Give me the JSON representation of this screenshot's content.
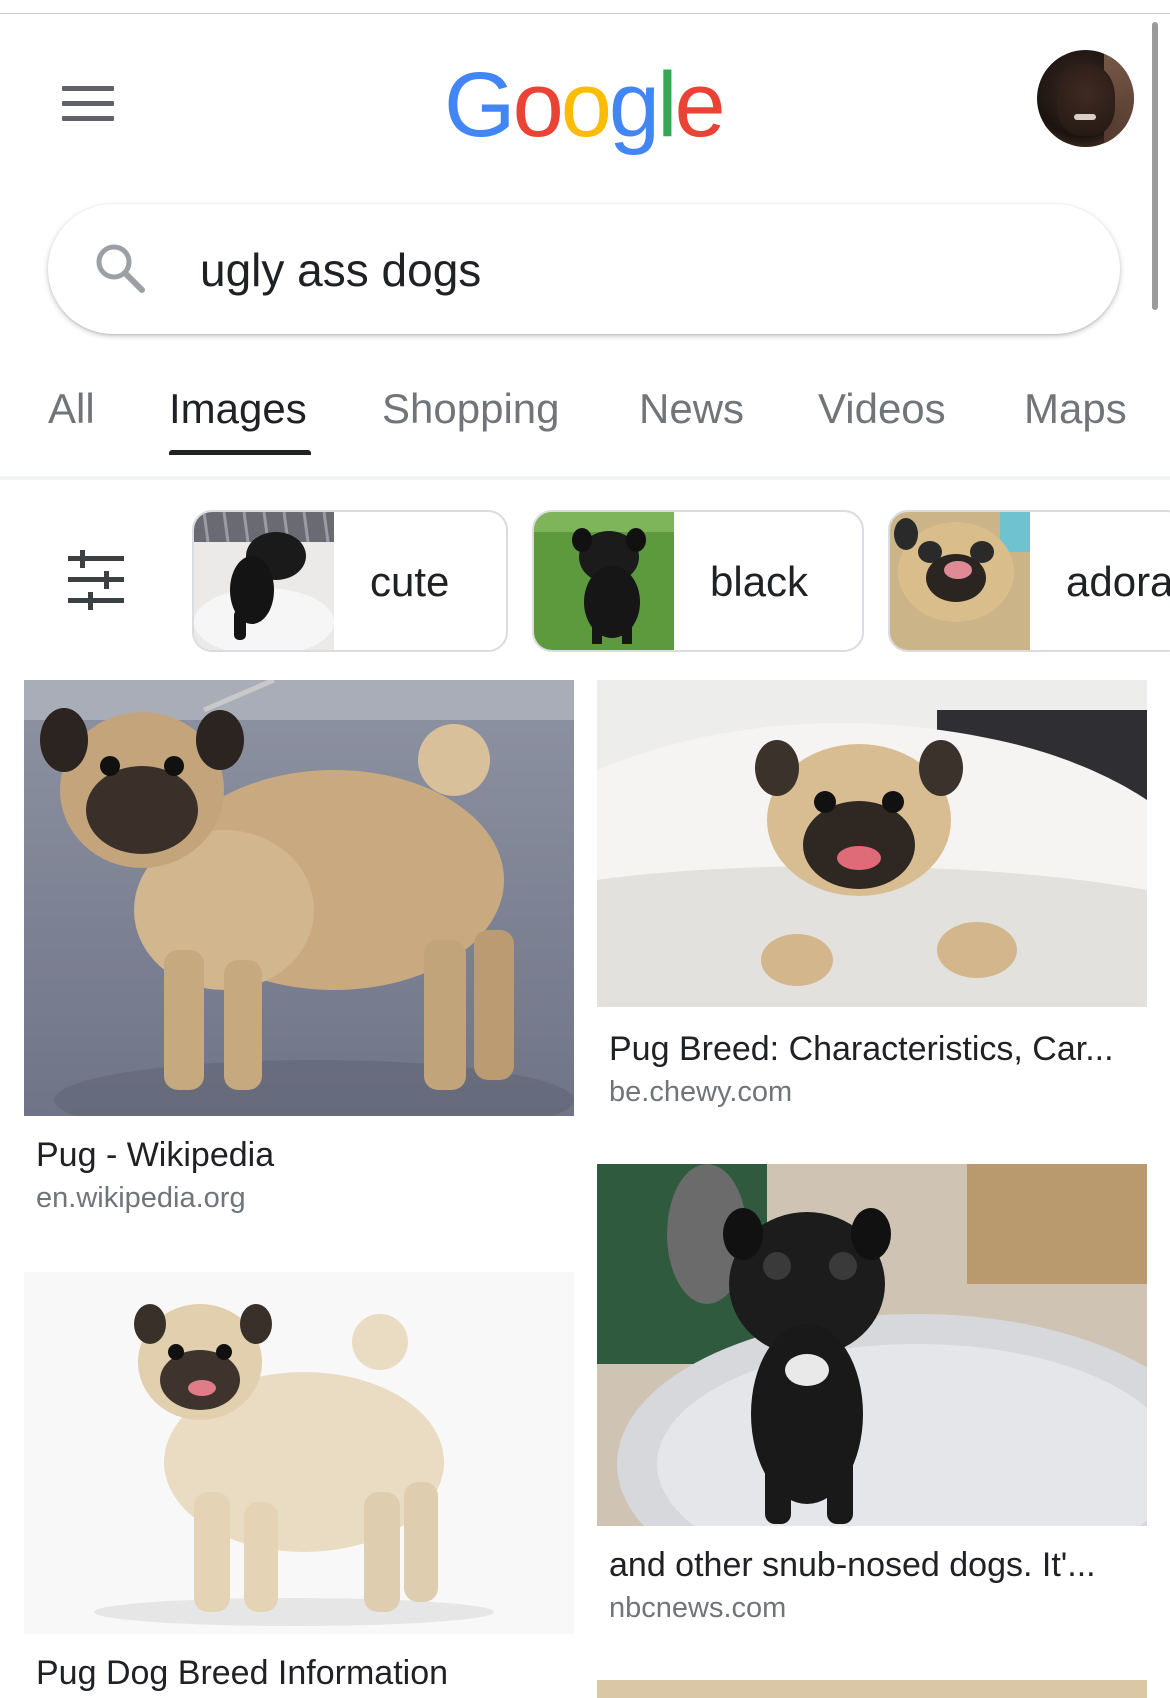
{
  "header": {
    "logo_letters": [
      "G",
      "o",
      "o",
      "g",
      "l",
      "e"
    ],
    "logo_colors": [
      "#4285F4",
      "#EA4335",
      "#FBBC05",
      "#4285F4",
      "#34A853",
      "#EA4335"
    ]
  },
  "search": {
    "query": "ugly ass dogs"
  },
  "tabs": [
    {
      "label": "All",
      "active": false
    },
    {
      "label": "Images",
      "active": true
    },
    {
      "label": "Shopping",
      "active": false
    },
    {
      "label": "News",
      "active": false
    },
    {
      "label": "Videos",
      "active": false
    },
    {
      "label": "Maps",
      "active": false
    }
  ],
  "chips": [
    {
      "label": "cute"
    },
    {
      "label": "black"
    },
    {
      "label": "adora"
    }
  ],
  "results": [
    {
      "title": "Pug - Wikipedia",
      "domain": "en.wikipedia.org"
    },
    {
      "title": "Pug Breed: Characteristics, Car...",
      "domain": "be.chewy.com"
    },
    {
      "title": "Pug Dog Breed Information",
      "domain": ""
    },
    {
      "title": "and other snub-nosed dogs. It'...",
      "domain": "nbcnews.com"
    }
  ],
  "colors": {
    "accent_text": "#202124",
    "muted_text": "#70757a",
    "chip_border": "#dadce0"
  },
  "icons": {
    "menu": "hamburger-icon",
    "search": "search-icon",
    "filter": "tune-icon"
  }
}
